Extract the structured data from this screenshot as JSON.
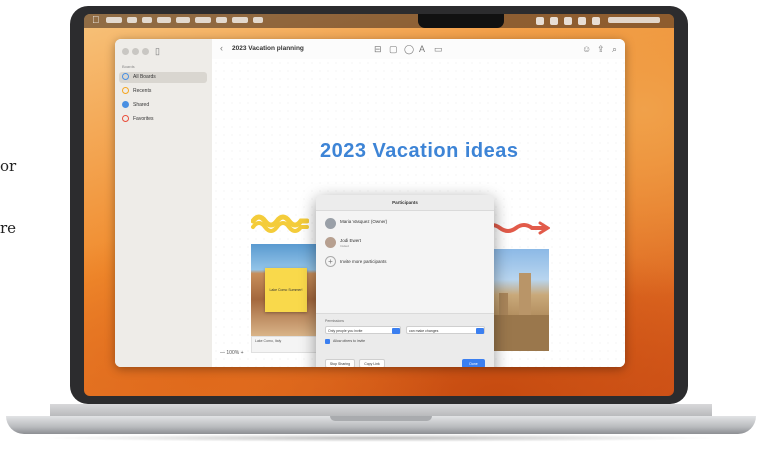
{
  "side_text": {
    "line1": "or",
    "line2": "re"
  },
  "menubar": {
    "apple_glyph": ""
  },
  "sidebar": {
    "section": "Boards",
    "items": [
      {
        "label": "All Boards",
        "count": "",
        "color": "#4a90e2"
      },
      {
        "label": "Recents",
        "count": "",
        "color": "#f5a623"
      },
      {
        "label": "Shared",
        "count": "",
        "color": "#4a90e2"
      },
      {
        "label": "Favorites",
        "count": "",
        "color": "#e94e3c"
      }
    ]
  },
  "toolbar": {
    "back_glyph": "‹",
    "title": "2023 Vacation planning"
  },
  "board": {
    "title": "2023 Vacation ideas",
    "sticky_text": "Lake Como Summer!",
    "photo_caption": "Lake Como, Italy",
    "zoom": "— 100% +"
  },
  "dialog": {
    "title": "Participants",
    "people": [
      {
        "name": "Maria Vasquez (Owner)",
        "sub": ""
      },
      {
        "name": "Jodi Ewert",
        "sub": "Invited"
      }
    ],
    "add_label": "Invite more participants",
    "permissions_label": "Permissions",
    "select_access": "Only people you invite",
    "select_role": "can make changes",
    "allow_label": "Allow others to invite",
    "copy_link": "Copy Link",
    "stop_sharing": "Stop Sharing",
    "done": "Done"
  },
  "colors": {
    "accent": "#3b7ff0",
    "title_blue": "#3d84d6",
    "sticky": "#f9d94b"
  }
}
